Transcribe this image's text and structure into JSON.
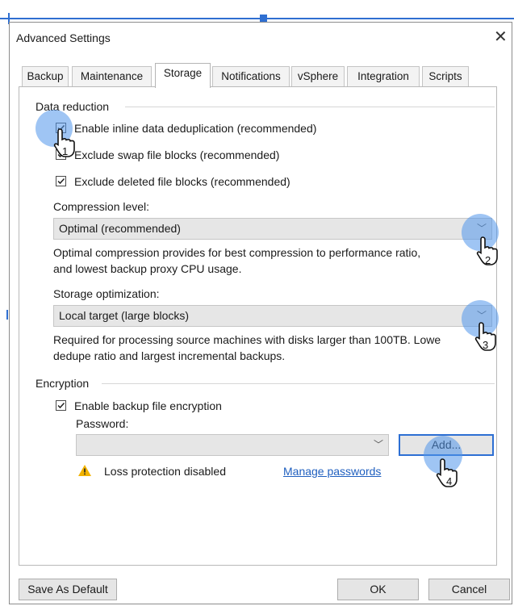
{
  "window": {
    "title": "Advanced Settings"
  },
  "tabs": [
    {
      "label": "Backup"
    },
    {
      "label": "Maintenance"
    },
    {
      "label": "Storage"
    },
    {
      "label": "Notifications"
    },
    {
      "label": "vSphere"
    },
    {
      "label": "Integration"
    },
    {
      "label": "Scripts"
    }
  ],
  "active_tab": "Storage",
  "data_reduction": {
    "heading": "Data reduction",
    "options": [
      {
        "label": "Enable inline data deduplication (recommended)",
        "checked": true
      },
      {
        "label": "Exclude swap file blocks (recommended)",
        "checked": true
      },
      {
        "label": "Exclude deleted file blocks (recommended)",
        "checked": true
      }
    ],
    "compression": {
      "label": "Compression level:",
      "value": "Optimal (recommended)",
      "description_line1": "Optimal compression provides for best compression to performance ratio,",
      "description_line2": "and lowest backup proxy CPU usage."
    },
    "optimization": {
      "label": "Storage optimization:",
      "value": "Local target (large blocks)",
      "description_line1": "Required for processing source machines with disks larger than 100TB. Lowe",
      "description_line2": "dedupe ratio and largest incremental backups."
    }
  },
  "encryption": {
    "heading": "Encryption",
    "enable_label": "Enable backup file encryption",
    "enable_checked": true,
    "password_label": "Password:",
    "password_value": "",
    "add_button": "Add...",
    "warning_text": "Loss protection disabled",
    "manage_link": "Manage passwords"
  },
  "footer": {
    "save_default": "Save As Default",
    "ok": "OK",
    "cancel": "Cancel"
  },
  "callouts": [
    "1",
    "2",
    "3",
    "4"
  ],
  "colors": {
    "accent": "#2f6fd1",
    "link": "#1f5fbf",
    "halo": "#5096eb",
    "warning": "#f2b300"
  }
}
